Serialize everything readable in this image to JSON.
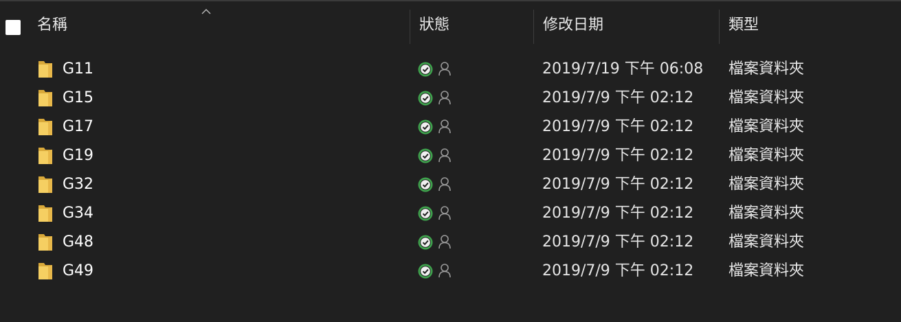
{
  "header": {
    "name": "名稱",
    "status": "狀態",
    "modified": "修改日期",
    "type": "類型",
    "sort_indicator": "chevron-up-icon"
  },
  "colors": {
    "background": "#202020",
    "folder": "#f1c453",
    "status_ok": "#3fa34d",
    "separator": "#3d3d3d"
  },
  "files": [
    {
      "name": "G11",
      "modified": "2019/7/19 下午 06:08",
      "type": "檔案資料夾",
      "icon": "folder-icon",
      "status": "available-on-device"
    },
    {
      "name": "G15",
      "modified": "2019/7/9 下午 02:12",
      "type": "檔案資料夾",
      "icon": "folder-icon",
      "status": "available-on-device"
    },
    {
      "name": "G17",
      "modified": "2019/7/9 下午 02:12",
      "type": "檔案資料夾",
      "icon": "folder-icon",
      "status": "available-on-device"
    },
    {
      "name": "G19",
      "modified": "2019/7/9 下午 02:12",
      "type": "檔案資料夾",
      "icon": "folder-icon",
      "status": "available-on-device"
    },
    {
      "name": "G32",
      "modified": "2019/7/9 下午 02:12",
      "type": "檔案資料夾",
      "icon": "folder-icon",
      "status": "available-on-device"
    },
    {
      "name": "G34",
      "modified": "2019/7/9 下午 02:12",
      "type": "檔案資料夾",
      "icon": "folder-icon",
      "status": "available-on-device"
    },
    {
      "name": "G48",
      "modified": "2019/7/9 下午 02:12",
      "type": "檔案資料夾",
      "icon": "folder-icon",
      "status": "available-on-device"
    },
    {
      "name": "G49",
      "modified": "2019/7/9 下午 02:12",
      "type": "檔案資料夾",
      "icon": "folder-icon",
      "status": "available-on-device"
    }
  ]
}
